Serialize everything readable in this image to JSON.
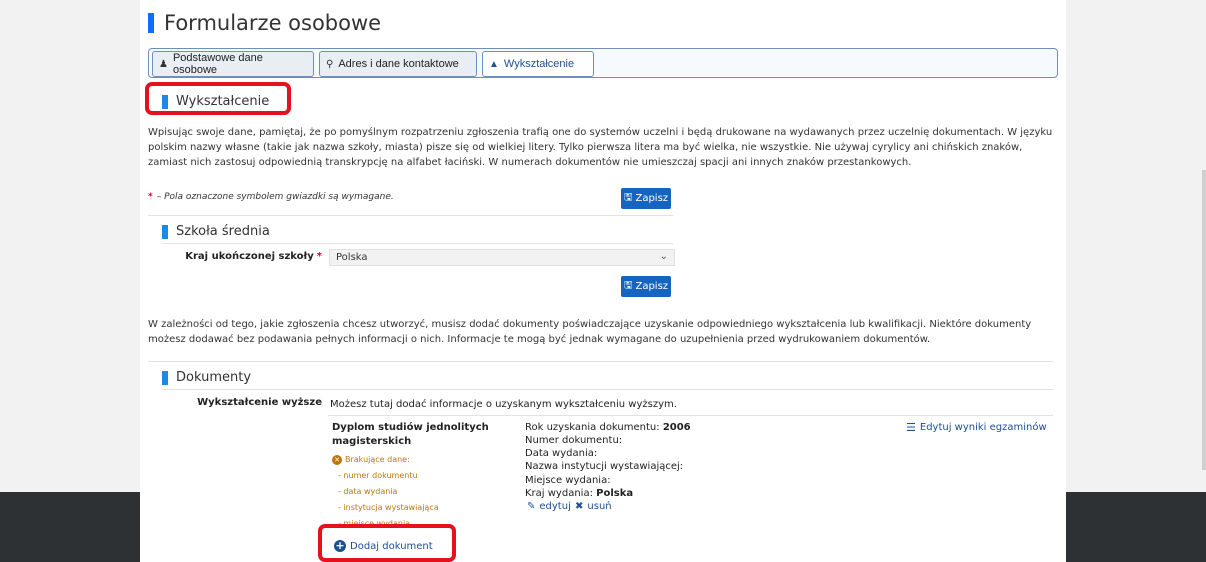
{
  "page_title": "Formularze osobowe",
  "tabs": [
    {
      "label": "Podstawowe dane osobowe",
      "icon": "person-icon"
    },
    {
      "label": "Adres i dane kontaktowe",
      "icon": "map-pin-icon"
    },
    {
      "label": "Wykształcenie",
      "icon": "graduation-cap-icon"
    }
  ],
  "education": {
    "heading": "Wykształcenie",
    "intro": "Wpisując swoje dane, pamiętaj, że po pomyślnym rozpatrzeniu zgłoszenia trafią one do systemów uczelni i będą drukowane na wydawanych przez uczelnię dokumentach. W języku polskim nazwy własne (takie jak nazwa szkoły, miasta) pisze się od wielkiej litery. Tylko pierwsza litera ma być wielka, nie wszystkie. Nie używaj cyrylicy ani chińskich znaków, zamiast nich zastosuj odpowiednią transkrypcję na alfabet łaciński. W numerach dokumentów nie umieszczaj spacji ani innych znaków przestankowych.",
    "required_star": "*",
    "required_note": "– Pola oznaczone symbolem gwiazdki są wymagane.",
    "save_label": "Zapisz"
  },
  "high_school": {
    "heading": "Szkoła średnia",
    "country_label": "Kraj ukończonej szkoły",
    "country_value": "Polska",
    "save_label": "Zapisz"
  },
  "documents_info": "W zależności od tego, jakie zgłoszenia chcesz utworzyć, musisz dodać dokumenty poświadczające uzyskanie odpowiedniego wykształcenia lub kwalifikacji. Niektóre dokumenty możesz dodawać bez podawania pełnych informacji o nich. Informacje te mogą być jednak wymagane do uzupełnienia przed wydrukowaniem dokumentów.",
  "documents": {
    "heading": "Dokumenty",
    "higher_label": "Wykształcenie wyższe",
    "higher_desc": "Możesz tutaj dodać informacje o uzyskanym wykształceniu wyższym.",
    "doc_title": "Dyplom studiów jednolitych magisterskich",
    "missing_heading": "Brakujące dane:",
    "missing_items": [
      "- numer dokumentu",
      "- data wydania",
      "- instytucja wystawiająca",
      "- miejsce wydania"
    ],
    "year_label": "Rok uzyskania dokumentu:",
    "year_value": "2006",
    "number_label": "Numer dokumentu:",
    "date_label": "Data wydania:",
    "institution_label": "Nazwa instytucji wystawiającej:",
    "place_label": "Miejsce wydania:",
    "country_label": "Kraj wydania:",
    "country_value": "Polska",
    "edit_label": "edytuj",
    "delete_label": "usuń",
    "edit_results_label": "Edytuj wyniki egzaminów",
    "add_label": "Dodaj dokument"
  },
  "colors": {
    "accent": "#1565c0",
    "highlight": "#e3121c",
    "warning": "#b9770e"
  }
}
